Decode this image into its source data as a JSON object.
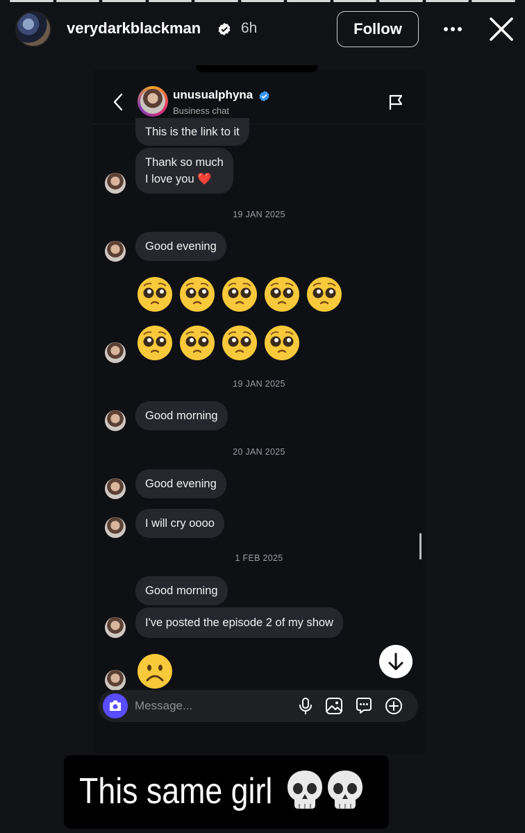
{
  "story": {
    "username": "verydarkblackman",
    "time": "6h",
    "follow_label": "Follow",
    "progress_segments": 11
  },
  "chat": {
    "contact_name": "unusualphyna",
    "contact_subtitle": "Business chat",
    "messages": [
      {
        "text": "This is the link to it"
      },
      {
        "line1": "Thank so much",
        "line2": "I love you ❤️"
      },
      {
        "date": "19 JAN 2025"
      },
      {
        "text": "Good evening"
      },
      {
        "emoji": "pleading-face",
        "count": 9
      },
      {
        "date": "19 JAN 2025"
      },
      {
        "text": "Good morning"
      },
      {
        "date": "20 JAN 2025"
      },
      {
        "text": "Good evening"
      },
      {
        "text": "I will cry oooo"
      },
      {
        "date": "1 FEB 2025"
      },
      {
        "text": "Good morning"
      },
      {
        "text": "I've posted the episode 2 of my show"
      },
      {
        "emoji": "frowning-face",
        "count": 1
      }
    ],
    "composer_placeholder": "Message..."
  },
  "caption": {
    "text": "This same girl",
    "emoji": "skull",
    "emoji_count": 2
  },
  "colors": {
    "background": "#111216",
    "bubble": "#26272d",
    "verified": "#3897f0",
    "camera_button": "#5a4cff"
  }
}
